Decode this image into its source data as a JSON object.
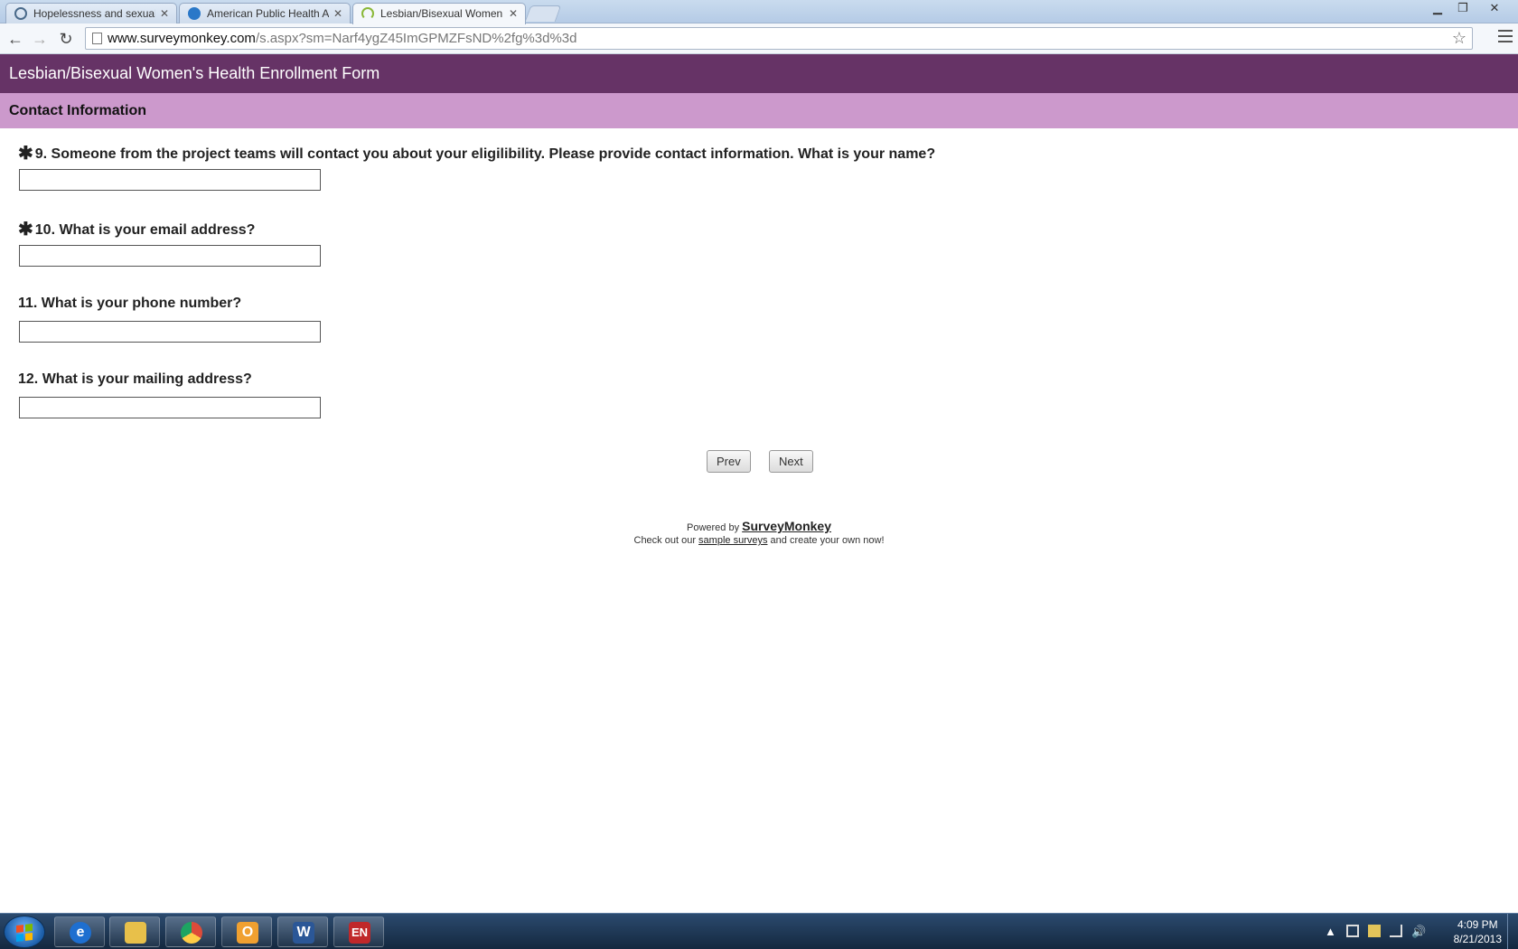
{
  "browser": {
    "tabs": [
      {
        "label": "Hopelessness and sexual r",
        "active": false
      },
      {
        "label": "American Public Health A",
        "active": false
      },
      {
        "label": "Lesbian/Bisexual Women's",
        "active": true
      }
    ],
    "url_host": "www.surveymonkey.com",
    "url_path": "/s.aspx?sm=Narf4ygZ45ImGPMZFsND%2fg%3d%3d"
  },
  "survey": {
    "title": "Lesbian/Bisexual Women's Health Enrollment Form",
    "section": "Contact Information",
    "required_marker": "✱",
    "questions": [
      {
        "text": "9. Someone from the project teams will contact you about your eligilibility. Please provide contact information. What is your name?",
        "required": true,
        "value": ""
      },
      {
        "text": "10. What is your email address?",
        "required": true,
        "value": ""
      },
      {
        "text": "11. What is your phone number?",
        "required": false,
        "value": ""
      },
      {
        "text": "12. What is your mailing address?",
        "required": false,
        "value": ""
      }
    ],
    "prev_label": "Prev",
    "next_label": "Next"
  },
  "footer": {
    "powered_by": "Powered by",
    "brand": "SurveyMonkey",
    "line2_prefix": "Check out our",
    "line2_link": "sample surveys",
    "line2_suffix": "and create your own now!"
  },
  "taskbar": {
    "time": "4:09 PM",
    "date": "8/21/2013",
    "colors": {
      "ie": "#1e6fd0",
      "explorer": "#e8c04a",
      "chrome": "#dd4b39",
      "outlook": "#f0a030",
      "word": "#2b5797",
      "em": "#c0282a"
    }
  }
}
